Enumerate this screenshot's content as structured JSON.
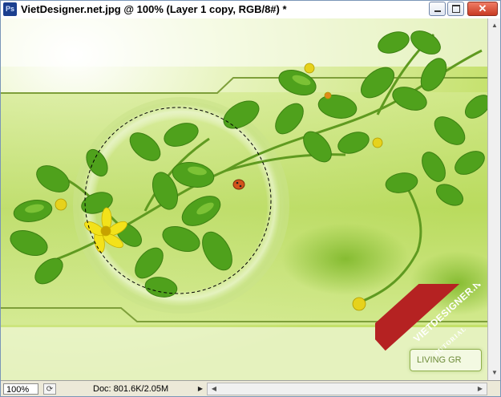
{
  "window": {
    "app_icon": "photoshop-icon",
    "app_icon_label": "Ps",
    "title": "VietDesigner.net.jpg @ 100% (Layer 1 copy, RGB/8#) *",
    "close_glyph": "✕"
  },
  "canvas": {
    "embedded_label": "LIVING GR",
    "watermark": {
      "text": "VIETDESIGNER.NET",
      "subtext": "TUTORIAL"
    },
    "colors": {
      "background": "#e8f3c8",
      "leaf": "#4fa11c",
      "band": "#8db83e",
      "flower": "#f3e21a",
      "ladybug": "#d3541c"
    }
  },
  "statusbar": {
    "zoom": "100%",
    "doc_info": "Doc: 801.6K/2.05M",
    "menu_arrow": "▶"
  },
  "scroll": {
    "up": "▲",
    "down": "▼",
    "left": "◀",
    "right": "▶"
  }
}
